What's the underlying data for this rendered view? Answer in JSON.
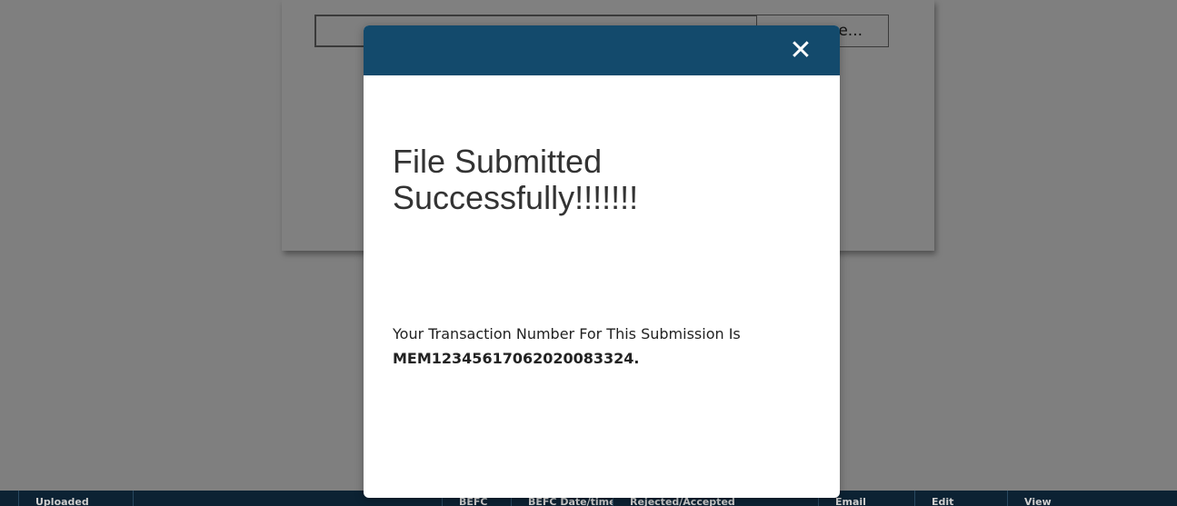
{
  "background": {
    "browse_button_label": "e...",
    "table_columns": [
      "Uploaded",
      "",
      "BEFC",
      "BEFC Date/time",
      "Rejected/Accepted",
      "Email",
      "Edit",
      "View"
    ]
  },
  "modal": {
    "close_label": "✕",
    "title": "File Submitted Successfully!!!!!!!",
    "message_prefix": "Your Transaction Number For This Submission Is",
    "transaction_number": "MEM12345617062020083324.",
    "header_color": "#134a6c"
  }
}
